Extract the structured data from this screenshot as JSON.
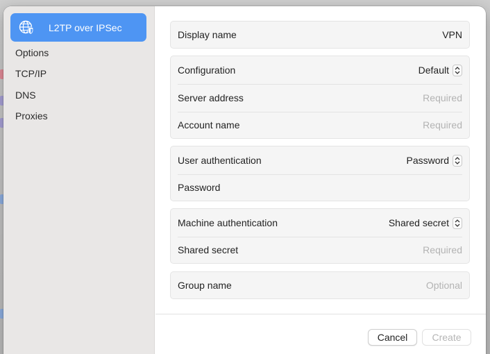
{
  "sidebar": {
    "selected": {
      "label": "L2TP over IPSec",
      "icon": "globe-shield-icon"
    },
    "items": [
      {
        "label": "Options"
      },
      {
        "label": "TCP/IP"
      },
      {
        "label": "DNS"
      },
      {
        "label": "Proxies"
      }
    ]
  },
  "form": {
    "display_name": {
      "label": "Display name",
      "value": "VPN"
    },
    "configuration": {
      "label": "Configuration",
      "value": "Default"
    },
    "server_address": {
      "label": "Server address",
      "placeholder": "Required"
    },
    "account_name": {
      "label": "Account name",
      "placeholder": "Required"
    },
    "user_authentication": {
      "label": "User authentication",
      "value": "Password"
    },
    "password": {
      "label": "Password",
      "value": ""
    },
    "machine_authentication": {
      "label": "Machine authentication",
      "value": "Shared secret"
    },
    "shared_secret": {
      "label": "Shared secret",
      "placeholder": "Required"
    },
    "group_name": {
      "label": "Group name",
      "placeholder": "Optional"
    }
  },
  "buttons": {
    "cancel": "Cancel",
    "create": "Create"
  },
  "colors": {
    "accent": "#4e95f3",
    "sidebar_bg": "#e9e7e6",
    "placeholder": "#b3b3b3"
  }
}
